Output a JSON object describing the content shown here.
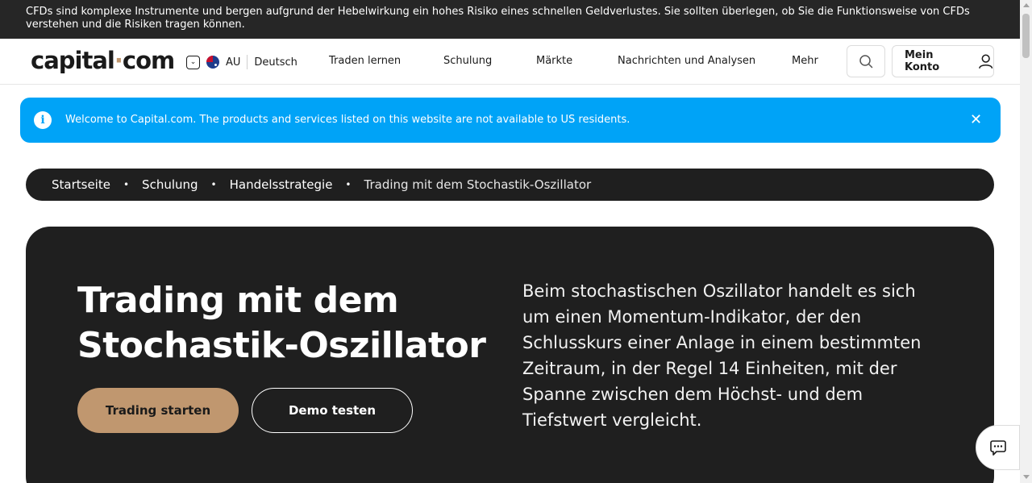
{
  "risk_warning": "CFDs sind komplexe Instrumente und bergen aufgrund der Hebelwirkung ein hohes Risiko eines schnellen Geldverlustes. Sie sollten überlegen, ob Sie die Funktionsweise von CFDs verstehen und die Risiken tragen können.",
  "header": {
    "logo_left": "capital",
    "logo_dot": "·",
    "logo_right": "com",
    "region_code": "AU",
    "language": "Deutsch",
    "nav": [
      "Traden lernen",
      "Schulung",
      "Märkte",
      "Nachrichten und Analysen",
      "Mehr"
    ],
    "account_label": "Mein Konto"
  },
  "notice": {
    "message": "Welcome to Capital.com. The products and services listed on this website are not available to US residents.",
    "close_symbol": "✕",
    "info_symbol": "i"
  },
  "breadcrumb": {
    "items": [
      "Startseite",
      "Schulung",
      "Handelsstrategie"
    ],
    "current": "Trading mit dem Stochastik-Oszillator",
    "separator": "•"
  },
  "hero": {
    "title_line1": "Trading mit dem",
    "title_line2": "Stochastik-Oszillator",
    "primary_button": "Trading starten",
    "secondary_button": "Demo testen",
    "description": "Beim stochastischen Oszillator handelt es sich um einen Momentum-Indikator, der den Schlusskurs einer Anlage in einem bestimmten Zeitraum, in der Regel 14 Einheiten, mit der Spanne zwischen dem Höchst- und dem Tiefstwert vergleicht."
  },
  "colors": {
    "accent": "#c0976f",
    "notice_bg": "#00a3f7",
    "dark_bg": "#1f1f1f"
  }
}
